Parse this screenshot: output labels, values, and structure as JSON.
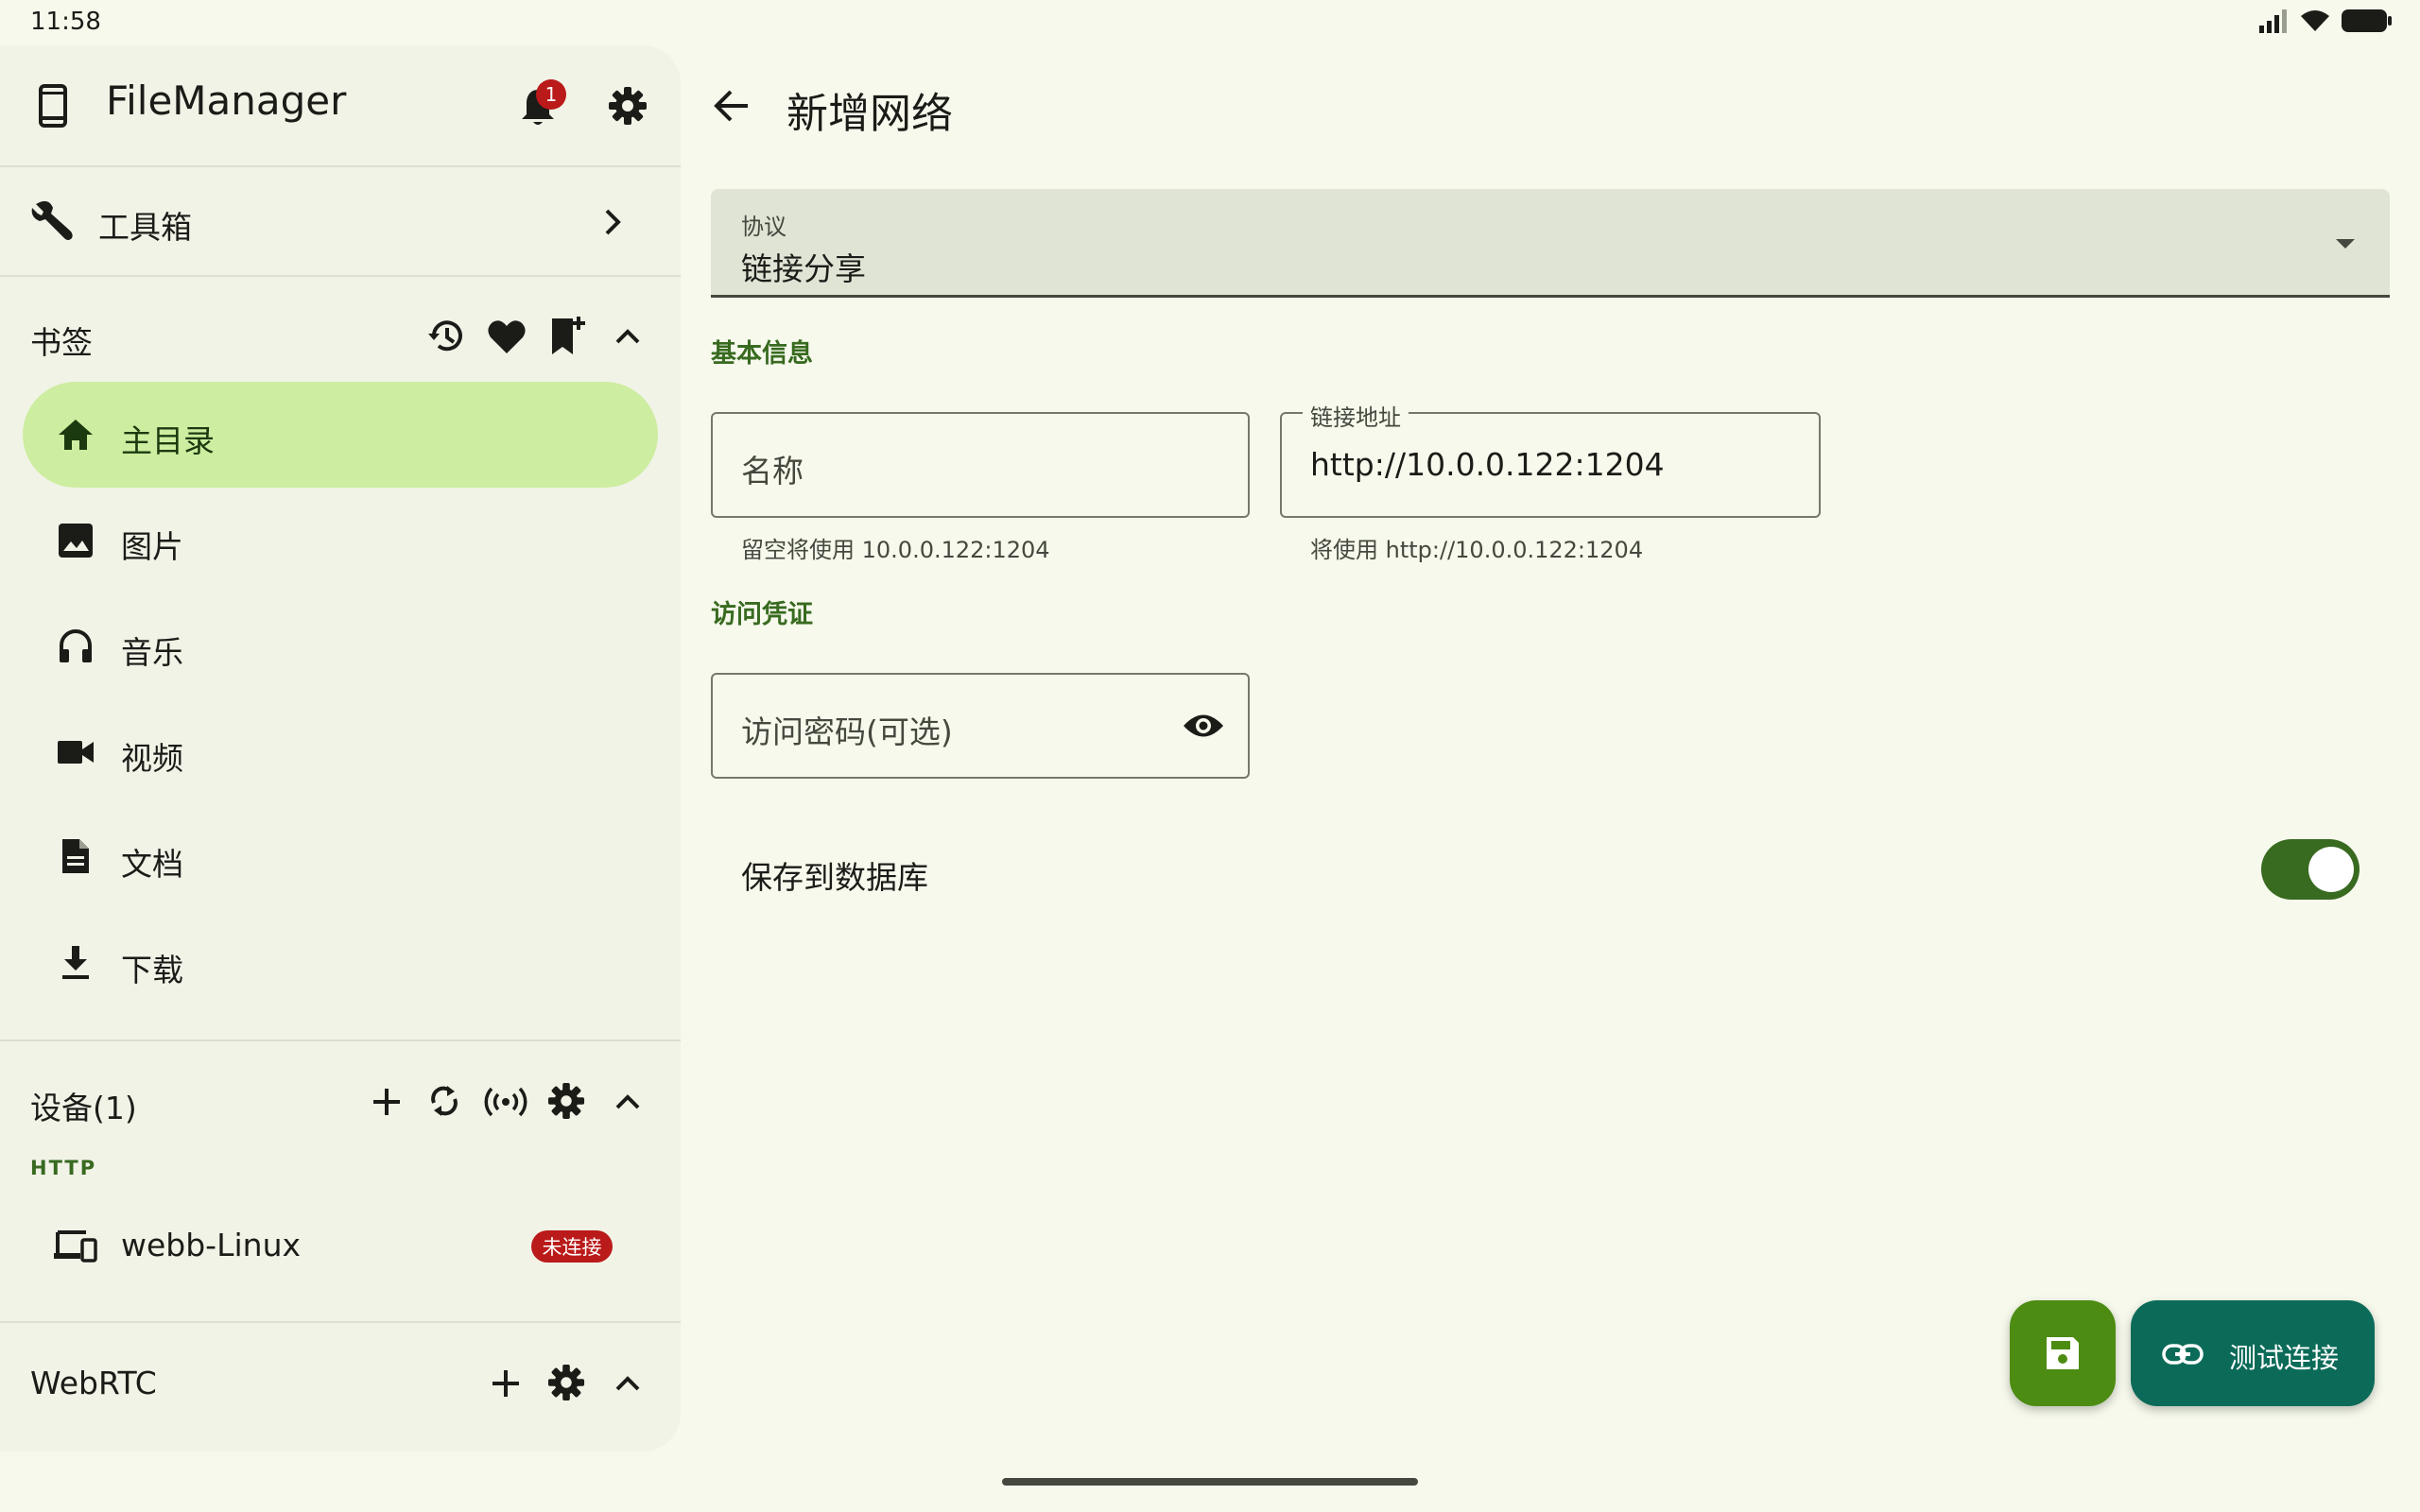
{
  "status_bar": {
    "time": "11:58"
  },
  "sidebar": {
    "app_title": "FileManager",
    "notification_count": "1",
    "toolbox_label": "工具箱",
    "bookmarks": {
      "title": "书签",
      "items": [
        {
          "label": "主目录",
          "icon": "home-icon",
          "selected": true
        },
        {
          "label": "图片",
          "icon": "image-icon"
        },
        {
          "label": "音乐",
          "icon": "headphones-icon"
        },
        {
          "label": "视频",
          "icon": "videocam-icon"
        },
        {
          "label": "文档",
          "icon": "document-icon"
        },
        {
          "label": "下载",
          "icon": "download-icon"
        }
      ]
    },
    "devices": {
      "title": "设备(1)",
      "group_label": "HTTP",
      "items": [
        {
          "label": "webb-Linux",
          "status": "未连接",
          "status_color": "#ba1a1a"
        }
      ]
    },
    "webrtc": {
      "title": "WebRTC"
    }
  },
  "main": {
    "page_title": "新增网络",
    "protocol": {
      "label": "协议",
      "value": "链接分享"
    },
    "basic_info": {
      "title": "基本信息",
      "name_placeholder": "名称",
      "name_helper": "留空将使用 10.0.0.122:1204",
      "url_label": "链接地址",
      "url_value": "http://10.0.0.122:1204",
      "url_helper": "将使用 http://10.0.0.122:1204"
    },
    "credentials": {
      "title": "访问凭证",
      "password_placeholder": "访问密码(可选)"
    },
    "save_to_db": {
      "label": "保存到数据库",
      "enabled": true
    },
    "actions": {
      "test_label": "测试连接"
    }
  },
  "colors": {
    "background": "#f6f9ec",
    "sidebar": "#f1f3e7",
    "accent": "#386a20",
    "selected_pill": "#cdeda0",
    "fab_save": "#4c8c12",
    "fab_test": "#0b6b58",
    "error": "#ba1a1a"
  }
}
